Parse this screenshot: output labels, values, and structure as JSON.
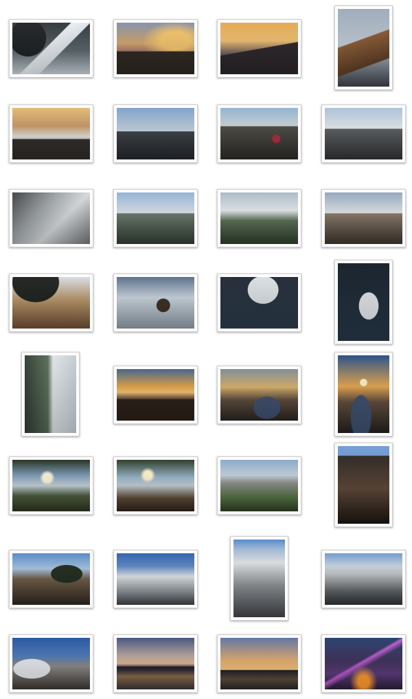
{
  "gallery": {
    "photos": [
      {
        "name": "snowy-path-photo",
        "scene": "snowpath",
        "orient": "land"
      },
      {
        "name": "sunset-peaks-photo",
        "scene": "sunset1",
        "orient": "land"
      },
      {
        "name": "golden-sky-peaks-photo",
        "scene": "sunset2",
        "orient": "land"
      },
      {
        "name": "cliff-portrait-photo",
        "scene": "cliffp",
        "orient": "port"
      },
      {
        "name": "sea-of-clouds-photo",
        "scene": "seaclouds",
        "orient": "land"
      },
      {
        "name": "valley-photo",
        "scene": "valley",
        "orient": "land"
      },
      {
        "name": "red-pavilion-photo",
        "scene": "redpavilion",
        "orient": "land"
      },
      {
        "name": "misty-peaks-photo",
        "scene": "mistpeaks",
        "orient": "land"
      },
      {
        "name": "frost-gorge-photo",
        "scene": "frost",
        "orient": "land"
      },
      {
        "name": "cloud-sea-photo",
        "scene": "cloudsea2",
        "orient": "land"
      },
      {
        "name": "mist-green-valley-photo",
        "scene": "mistgreen",
        "orient": "land"
      },
      {
        "name": "clouds-over-ridge-photo",
        "scene": "seaclouds3",
        "orient": "land"
      },
      {
        "name": "pine-peak-photo",
        "scene": "pinepeak",
        "orient": "land"
      },
      {
        "name": "snow-tree-photo",
        "scene": "snowtree",
        "orient": "land"
      },
      {
        "name": "snow-branch-photo",
        "scene": "snowbranch",
        "orient": "land"
      },
      {
        "name": "snow-branch-portrait-photo",
        "scene": "snowbranchp",
        "orient": "port"
      },
      {
        "name": "misty-cliff-portrait-photo",
        "scene": "mistyp",
        "orient": "port"
      },
      {
        "name": "sunrise-peaks-photo",
        "scene": "sunrise1",
        "orient": "land"
      },
      {
        "name": "golden-rocks-photo",
        "scene": "goldenrock",
        "orient": "land"
      },
      {
        "name": "sunrise-portrait-photo",
        "scene": "sunrisep",
        "orient": "port"
      },
      {
        "name": "sunburst-photo",
        "scene": "sunburst",
        "orient": "land"
      },
      {
        "name": "sun-bridge-photo",
        "scene": "sunbridge",
        "orient": "land"
      },
      {
        "name": "blue-mountains-photo",
        "scene": "bluemount",
        "orient": "land"
      },
      {
        "name": "cave-portrait-photo",
        "scene": "cavep",
        "orient": "port"
      },
      {
        "name": "pine-cliff-photo",
        "scene": "pinecliff",
        "orient": "land"
      },
      {
        "name": "blue-frost-photo",
        "scene": "bluefrost",
        "orient": "land"
      },
      {
        "name": "stairs-portrait-photo",
        "scene": "stairsp",
        "orient": "port"
      },
      {
        "name": "frost-gorge-2-photo",
        "scene": "frostgorge",
        "orient": "land"
      },
      {
        "name": "blue-snow-tree-photo",
        "scene": "bluesnowtree",
        "orient": "land"
      },
      {
        "name": "shanghai-skyline-photo",
        "scene": "shanghai1",
        "orient": "land"
      },
      {
        "name": "shanghai-dusk-photo",
        "scene": "shanghai2",
        "orient": "land"
      },
      {
        "name": "highway-interchange-photo",
        "scene": "interchange",
        "orient": "land"
      }
    ]
  }
}
